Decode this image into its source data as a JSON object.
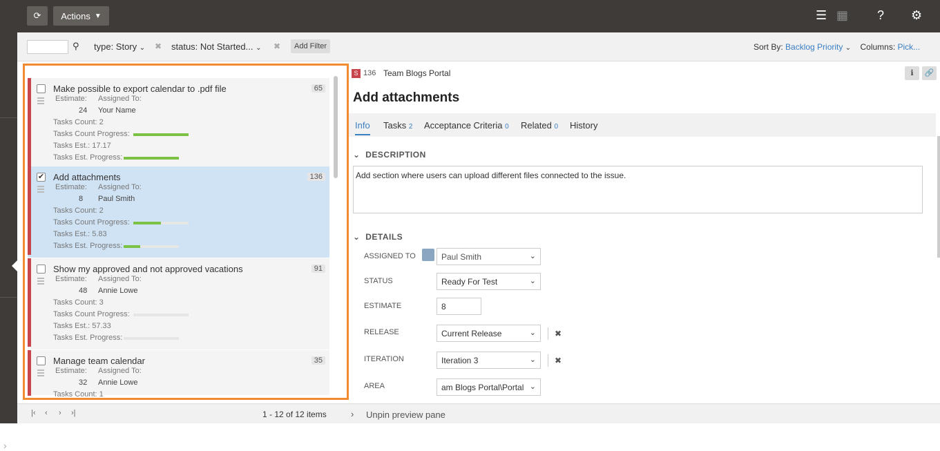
{
  "toolbar": {
    "actions_label": "Actions"
  },
  "filters": {
    "type": "type: Story",
    "status": "status: Not Started...",
    "add_filter": "Add Filter",
    "sort_by_label": "Sort By:",
    "sort_by_value": "Backlog Priority",
    "columns_label": "Columns:",
    "columns_value": "Pick..."
  },
  "list": {
    "items": [
      {
        "title": "Make possible to export calendar to .pdf file",
        "id": "65",
        "estimate_label": "Estimate:",
        "estimate": "24",
        "assigned_label": "Assigned To:",
        "assigned": "Your Name",
        "tasks_count": "Tasks Count: 2",
        "tasks_progress_label": "Tasks Count Progress:",
        "tasks_progress": 1.0,
        "tasks_est": "Tasks Est.: 17.17",
        "tasks_est_progress_label": "Tasks Est. Progress:",
        "tasks_est_progress": 1.0,
        "checked": false
      },
      {
        "title": "Add attachments",
        "id": "136",
        "estimate_label": "Estimate:",
        "estimate": "8",
        "assigned_label": "Assigned To:",
        "assigned": "Paul Smith",
        "tasks_count": "Tasks Count: 2",
        "tasks_progress_label": "Tasks Count Progress:",
        "tasks_progress": 0.5,
        "tasks_est": "Tasks Est.: 5.83",
        "tasks_est_progress_label": "Tasks Est. Progress:",
        "tasks_est_progress": 0.3,
        "checked": true
      },
      {
        "title": "Show my approved and not approved vacations",
        "id": "91",
        "estimate_label": "Estimate:",
        "estimate": "48",
        "assigned_label": "Assigned To:",
        "assigned": "Annie Lowe",
        "tasks_count": "Tasks Count: 3",
        "tasks_progress_label": "Tasks Count Progress:",
        "tasks_progress": 0.0,
        "tasks_est": "Tasks Est.: 57.33",
        "tasks_est_progress_label": "Tasks Est. Progress:",
        "tasks_est_progress": 0.0,
        "checked": false
      },
      {
        "title": "Manage team calendar",
        "id": "35",
        "estimate_label": "Estimate:",
        "estimate": "32",
        "assigned_label": "Assigned To:",
        "assigned": "Annie Lowe",
        "tasks_count": "Tasks Count: 1",
        "checked": false
      }
    ],
    "count_text": "1 - 12 of 12 items"
  },
  "detail": {
    "type_badge": "S",
    "id": "136",
    "project": "Team Blogs Portal",
    "title": "Add attachments",
    "tabs": [
      {
        "label": "Info",
        "count": ""
      },
      {
        "label": "Tasks",
        "count": "2"
      },
      {
        "label": "Acceptance Criteria",
        "count": "0"
      },
      {
        "label": "Related",
        "count": "0"
      },
      {
        "label": "History",
        "count": ""
      }
    ],
    "description_heading": "DESCRIPTION",
    "description": "Add section where users can upload different files connected to the issue.",
    "details_heading": "DETAILS",
    "fields": {
      "assigned_label": "ASSIGNED TO",
      "assigned": "Paul Smith",
      "status_label": "STATUS",
      "status": "Ready For Test",
      "estimate_label": "ESTIMATE",
      "estimate": "8",
      "release_label": "RELEASE",
      "release": "Current Release",
      "iteration_label": "ITERATION",
      "iteration": "Iteration 3",
      "area_label": "AREA",
      "area": "am Blogs Portal\\Portal"
    },
    "unpin": "Unpin preview pane"
  },
  "icons": {
    "refresh": "refresh-icon",
    "search": "search-icon",
    "list_view": "list-view-icon",
    "board_view": "board-view-icon",
    "help": "help-icon",
    "settings": "gear-icon",
    "info": "info-icon",
    "link": "link-icon"
  }
}
